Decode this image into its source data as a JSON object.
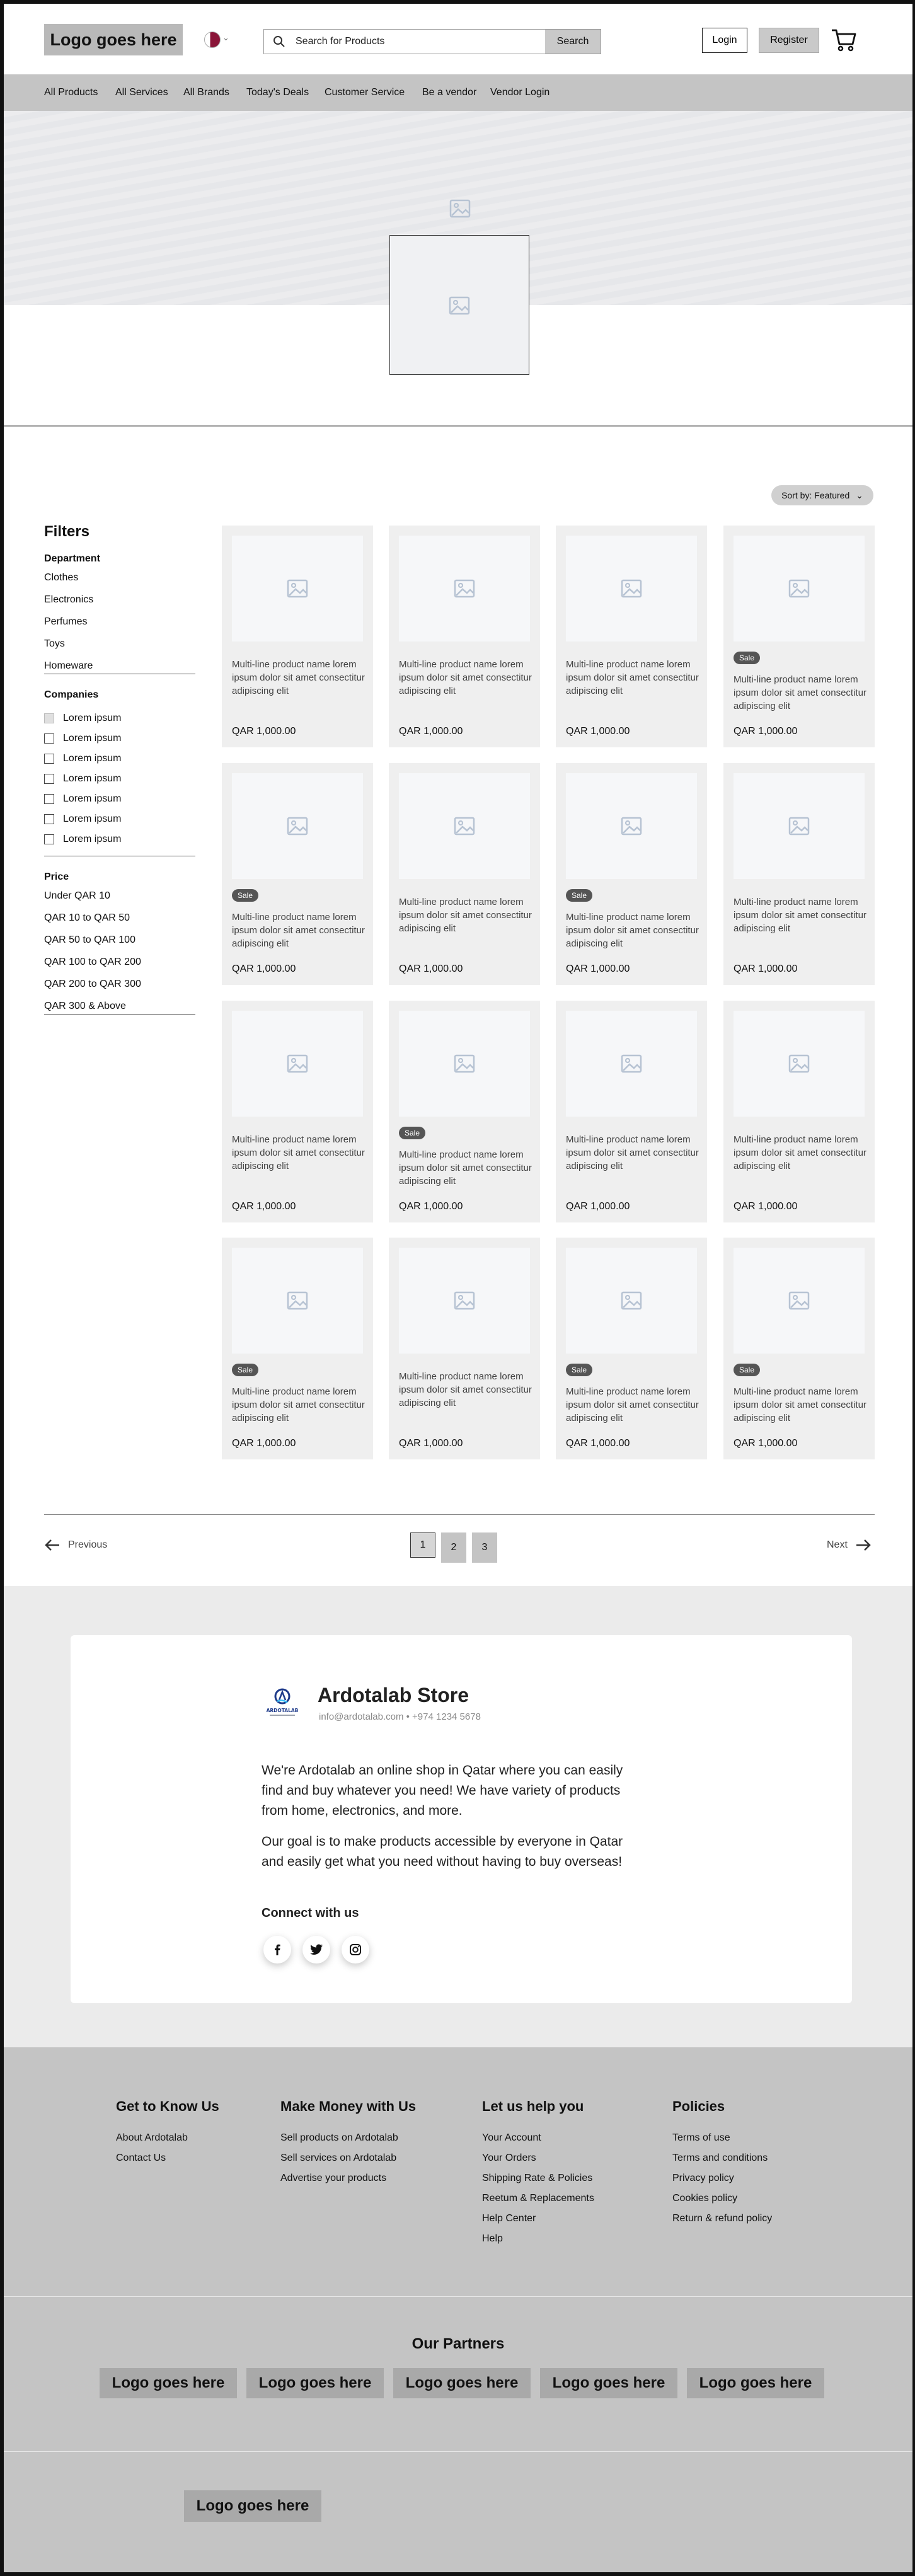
{
  "header": {
    "logo": "Logo goes here",
    "flag_icon": "qatar-flag-icon",
    "search_placeholder": "Search for Products",
    "search_button": "Search",
    "login": "Login",
    "register": "Register",
    "cart_icon": "cart-icon"
  },
  "nav": [
    "All Products",
    "All Services",
    "All Brands",
    "Today's Deals",
    "Customer Service",
    "Be a vendor",
    "Vendor Login"
  ],
  "sort": {
    "label": "Sort by: Featured"
  },
  "filters": {
    "title": "Filters",
    "department_title": "Department",
    "departments": [
      "Clothes",
      "Electronics",
      "Perfumes",
      "Toys",
      "Homeware"
    ],
    "companies_title": "Companies",
    "companies": [
      "Lorem ipsum",
      "Lorem ipsum",
      "Lorem ipsum",
      "Lorem ipsum",
      "Lorem ipsum",
      "Lorem ipsum",
      "Lorem ipsum"
    ],
    "price_title": "Price",
    "prices": [
      "Under QAR 10",
      "QAR 10 to QAR 50",
      "QAR 50 to QAR 100",
      "QAR 100 to QAR 200",
      "QAR 200 to QAR 300",
      "QAR 300 & Above"
    ]
  },
  "products": {
    "name": "Multi-line product name lorem ipsum dolor sit amet consectitur adipiscing elit",
    "price": "QAR 1,000.00",
    "sale_label": "Sale",
    "sale_flags": [
      false,
      false,
      false,
      true,
      true,
      false,
      true,
      false,
      false,
      true,
      false,
      false,
      true,
      false,
      true,
      true
    ]
  },
  "pagination": {
    "previous": "Previous",
    "next": "Next",
    "pages": [
      "1",
      "2",
      "3"
    ],
    "current": "1"
  },
  "about": {
    "store_name": "Ardotalab Store",
    "logo_text": "ARDOTALAB",
    "contact": "info@ardotalab.com • +974 1234 5678",
    "paragraph1": "We're Ardotalab an online shop in Qatar where you can easily find and buy whatever you need! We have  variety of products from home, electronics, and more.",
    "paragraph2": "Our goal is to make products accessible by everyone in Qatar and easily get what you need without having to buy overseas!",
    "connect_title": "Connect with us",
    "socials": [
      "facebook-icon",
      "twitter-icon",
      "instagram-icon"
    ]
  },
  "footer": {
    "columns": [
      {
        "title": "Get to Know Us",
        "links": [
          "About Ardotalab",
          "Contact Us"
        ]
      },
      {
        "title": "Make Money with Us",
        "links": [
          "Sell products on Ardotalab",
          "Sell services on Ardotalab",
          "Advertise your products"
        ]
      },
      {
        "title": "Let us help you",
        "links": [
          "Your Account",
          "Your Orders",
          "Shipping Rate & Policies",
          "Reetum & Replacements",
          "Help Center",
          "Help"
        ]
      },
      {
        "title": "Policies",
        "links": [
          "Terms of use",
          "Terms and conditions",
          "Privacy policy",
          "Cookies policy",
          "Return & refund policy"
        ]
      }
    ],
    "partners_title": "Our Partners",
    "partners": [
      "Logo goes here",
      "Logo goes here",
      "Logo goes here",
      "Logo goes here",
      "Logo goes here"
    ],
    "bottom_logo": "Logo goes here"
  }
}
